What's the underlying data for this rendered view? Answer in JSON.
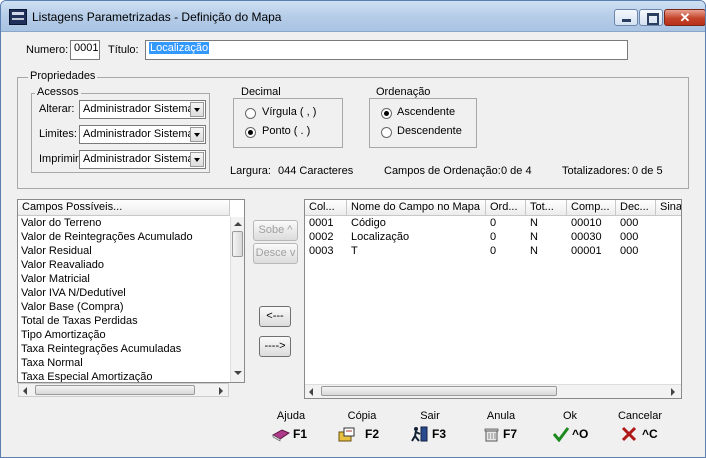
{
  "window": {
    "title": "Listagens Parametrizadas - Definição do Mapa"
  },
  "header": {
    "numero_label": "Numero:",
    "numero_value": "0001",
    "titulo_label": "Título:",
    "titulo_value": "Localização"
  },
  "propriedades": {
    "label": "Propriedades",
    "acessos": {
      "label": "Acessos",
      "alterar_label": "Alterar:",
      "alterar_value": "Administrador Sistema",
      "limites_label": "Limites:",
      "limites_value": "Administrador Sistema",
      "imprimir_label": "Imprimir:",
      "imprimir_value": "Administrador Sistema"
    },
    "decimal": {
      "label": "Decimal",
      "virgula": "Vírgula ( , )",
      "ponto": "Ponto ( . )",
      "selected": "ponto"
    },
    "ordenacao": {
      "label": "Ordenação",
      "ascendente": "Ascendente",
      "descendente": "Descendente",
      "selected": "ascendente"
    },
    "largura_label": "Largura:",
    "largura_value": "044 Caracteres",
    "campos_ordenacao_label": "Campos de Ordenação:",
    "campos_ordenacao_value": "0 de 4",
    "totalizadores_label": "Totalizadores:",
    "totalizadores_value": "0 de 5"
  },
  "campos_possiveis": {
    "header": "Campos Possíveis...",
    "items": [
      "Valor do Terreno",
      "Valor de Reintegrações Acumulado",
      "Valor Residual",
      "Valor Reavaliado",
      "Valor Matricial",
      "Valor IVA N/Dedutível",
      "Valor Base (Compra)",
      "Total de Taxas Perdidas",
      "Tipo Amortização",
      "Taxa Reintegrações Acumuladas",
      "Taxa Normal",
      "Taxa Especial Amortização"
    ]
  },
  "move_buttons": {
    "sobe": "Sobe ^",
    "desce": "Desce v",
    "left": "<---",
    "right": "---->"
  },
  "map_table": {
    "columns": [
      "Col...",
      "Nome do Campo no Mapa",
      "Ord...",
      "Tot...",
      "Comp...",
      "Dec...",
      "Sina"
    ],
    "rows": [
      [
        "0001",
        "Código",
        "0",
        "N",
        "00010",
        "000"
      ],
      [
        "0002",
        "Localização",
        "0",
        "N",
        "00030",
        "000"
      ],
      [
        "0003",
        "T",
        "0",
        "N",
        "00001",
        "000"
      ]
    ]
  },
  "footer": {
    "ajuda": {
      "title": "Ajuda",
      "key": "F1",
      "icon": "book-icon"
    },
    "copia": {
      "title": "Cópia",
      "key": "F2",
      "icon": "copy-icon"
    },
    "sair": {
      "title": "Sair",
      "key": "F3",
      "icon": "exit-icon"
    },
    "anula": {
      "title": "Anula",
      "key": "F7",
      "icon": "trash-icon"
    },
    "ok": {
      "title": "Ok",
      "key": "^O",
      "icon": "check-icon"
    },
    "cancelar": {
      "title": "Cancelar",
      "key": "^C",
      "icon": "cancel-icon"
    }
  }
}
